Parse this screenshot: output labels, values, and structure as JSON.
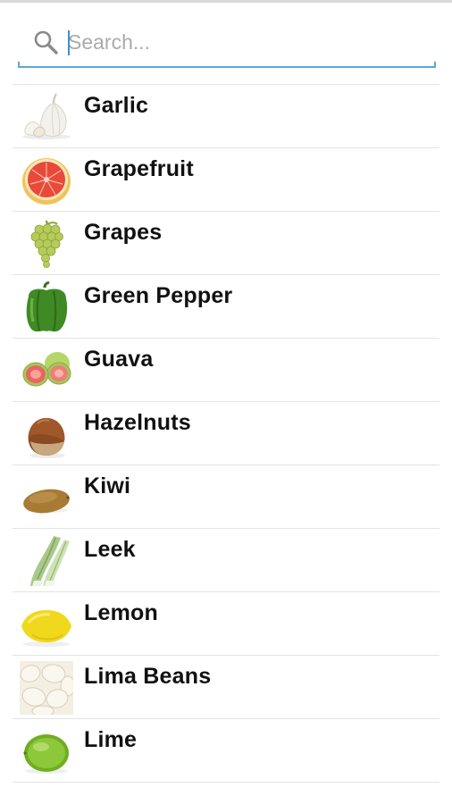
{
  "search": {
    "placeholder": "Search...",
    "value": "",
    "icon": "search-icon",
    "accent_color": "#5aa7e0"
  },
  "items": [
    {
      "label": "Garlic",
      "icon": "garlic-icon"
    },
    {
      "label": "Grapefruit",
      "icon": "grapefruit-icon"
    },
    {
      "label": "Grapes",
      "icon": "grapes-icon"
    },
    {
      "label": "Green Pepper",
      "icon": "green-pepper-icon"
    },
    {
      "label": "Guava",
      "icon": "guava-icon"
    },
    {
      "label": "Hazelnuts",
      "icon": "hazelnut-icon"
    },
    {
      "label": "Kiwi",
      "icon": "kiwi-icon"
    },
    {
      "label": "Leek",
      "icon": "leek-icon"
    },
    {
      "label": "Lemon",
      "icon": "lemon-icon"
    },
    {
      "label": "Lima Beans",
      "icon": "lima-beans-icon"
    },
    {
      "label": "Lime",
      "icon": "lime-icon"
    }
  ]
}
